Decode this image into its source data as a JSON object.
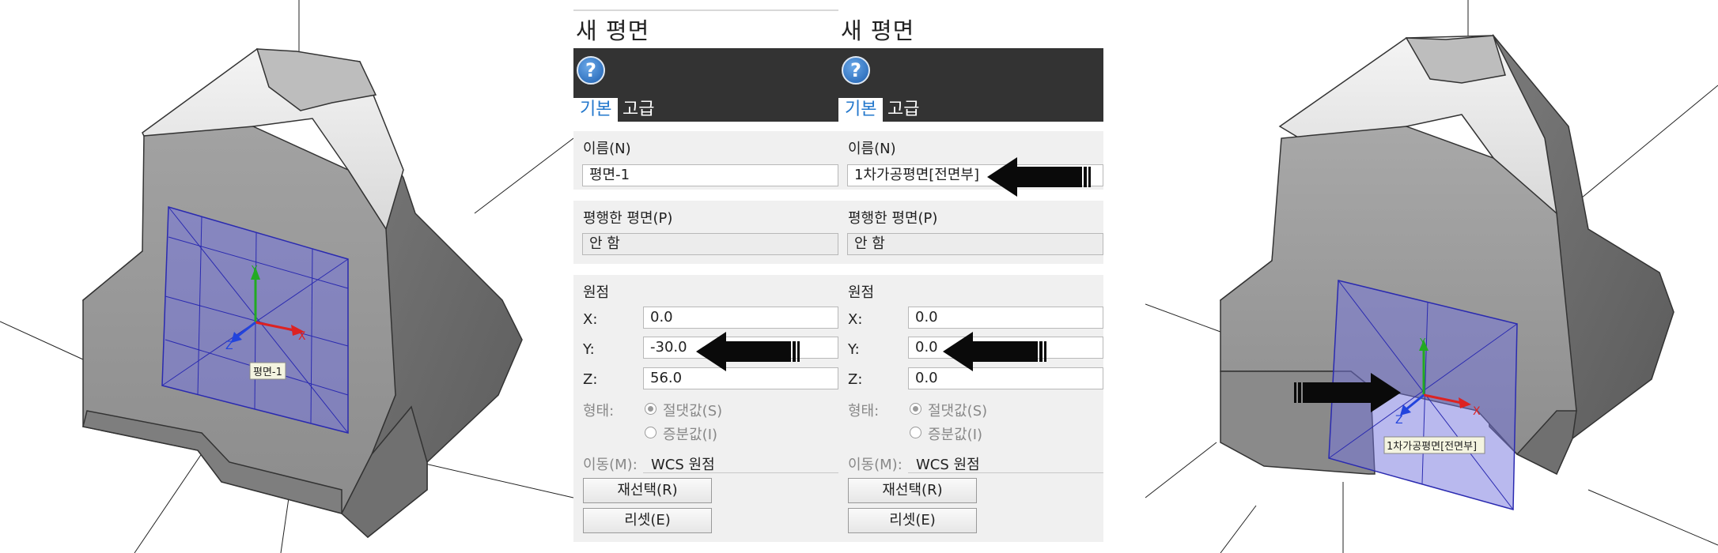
{
  "viewport_left": {
    "plane_label": "평면-1",
    "axis_labels": {
      "x": "X",
      "y": "Y",
      "z": "Z"
    },
    "colors": {
      "plane_fill": "#7474dd",
      "x_axis": "#dd2222",
      "y_axis": "#22aa22",
      "z_axis": "#2244dd",
      "body": "#808080"
    }
  },
  "viewport_right": {
    "plane_label": "1차가공평면[전면부]",
    "axis_labels": {
      "x": "X",
      "y": "Y",
      "z": "Z"
    }
  },
  "panels": [
    {
      "title": "새 평면",
      "help_icon": "help-icon",
      "tabs": {
        "basic": "기본",
        "advanced": "고급"
      },
      "name_label": "이름(N)",
      "name_value": "평면-1",
      "parallel_label": "평행한 평면(P)",
      "parallel_value": "안 함",
      "origin_label": "원점",
      "x_label": "X:",
      "x_value": "0.0",
      "y_label": "Y:",
      "y_value": "-30.0",
      "z_label": "Z:",
      "z_value": "56.0",
      "type_label": "형태:",
      "absolute_label": "절댓값(S)",
      "increment_label": "증분값(I)",
      "move_label": "이동(M):",
      "move_value": "WCS 원점",
      "reselect_button": "재선택(R)",
      "reset_button": "리셋(E)"
    },
    {
      "title": "새 평면",
      "help_icon": "help-icon",
      "tabs": {
        "basic": "기본",
        "advanced": "고급"
      },
      "name_label": "이름(N)",
      "name_value": "1차가공평면[전면부]",
      "parallel_label": "평행한 평면(P)",
      "parallel_value": "안 함",
      "origin_label": "원점",
      "x_label": "X:",
      "x_value": "0.0",
      "y_label": "Y:",
      "y_value": "0.0",
      "z_label": "Z:",
      "z_value": "0.0",
      "type_label": "형태:",
      "absolute_label": "절댓값(S)",
      "increment_label": "증분값(I)",
      "move_label": "이동(M):",
      "move_value": "WCS 원점",
      "reselect_button": "재선택(R)",
      "reset_button": "리셋(E)"
    }
  ]
}
